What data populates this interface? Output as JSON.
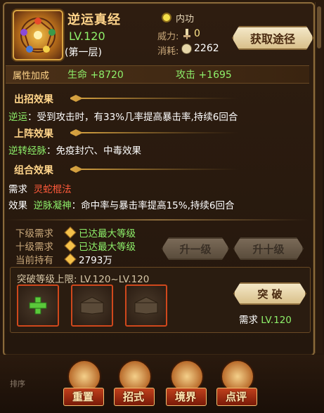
{
  "skill": {
    "name": "逆运真经",
    "level": "LV.120",
    "layer": "(第一层)",
    "kind": "内功",
    "power_label": "威力:",
    "power_value": "0",
    "cost_label": "消耗:",
    "cost_value": "2262",
    "obtain_button": "获取途径"
  },
  "attributes": {
    "title": "属性加成",
    "hp": "生命 +8720",
    "atk": "攻击 +1695"
  },
  "effects": {
    "attack_title": "出招效果",
    "attack_name": "逆运",
    "attack_desc": "：受到攻击时，有33%几率提高暴击率,持续6回合",
    "deploy_title": "上阵效果",
    "deploy_name": "逆转经脉",
    "deploy_desc": "：免疫封穴、中毒效果",
    "combo_title": "组合效果",
    "combo_req_label": "需求",
    "combo_req_value": "灵蛇棍法",
    "combo_effect_label": "效果",
    "combo_effect_name": "逆脉凝神",
    "combo_effect_desc": "：命中率与暴击率提高15%,持续6回合"
  },
  "upgrade": {
    "next_label": "下级需求",
    "next_value": "已达最大等级",
    "ten_label": "十级需求",
    "ten_value": "已达最大等级",
    "owned_label": "当前持有",
    "owned_value": "2793万",
    "lvup1_button": "升一级",
    "lvup10_button": "升十级"
  },
  "breakthrough": {
    "limit_label": "突破等级上限: LV.120~LV.120",
    "button": "突 破",
    "req_label": "需求",
    "req_value": "LV.120"
  },
  "bottom_tabs": [
    {
      "label": "重置",
      "icon": "reset-icon"
    },
    {
      "label": "招式",
      "icon": "moves-icon"
    },
    {
      "label": "境界",
      "icon": "realm-icon"
    },
    {
      "label": "点评",
      "icon": "thumbs-up-icon"
    }
  ],
  "sort_label": "排序",
  "colors": {
    "gold_text": "#ffd48a",
    "green_value": "#8ef06a",
    "red_value": "#ff5a3a",
    "frame": "#8a6a3a"
  }
}
